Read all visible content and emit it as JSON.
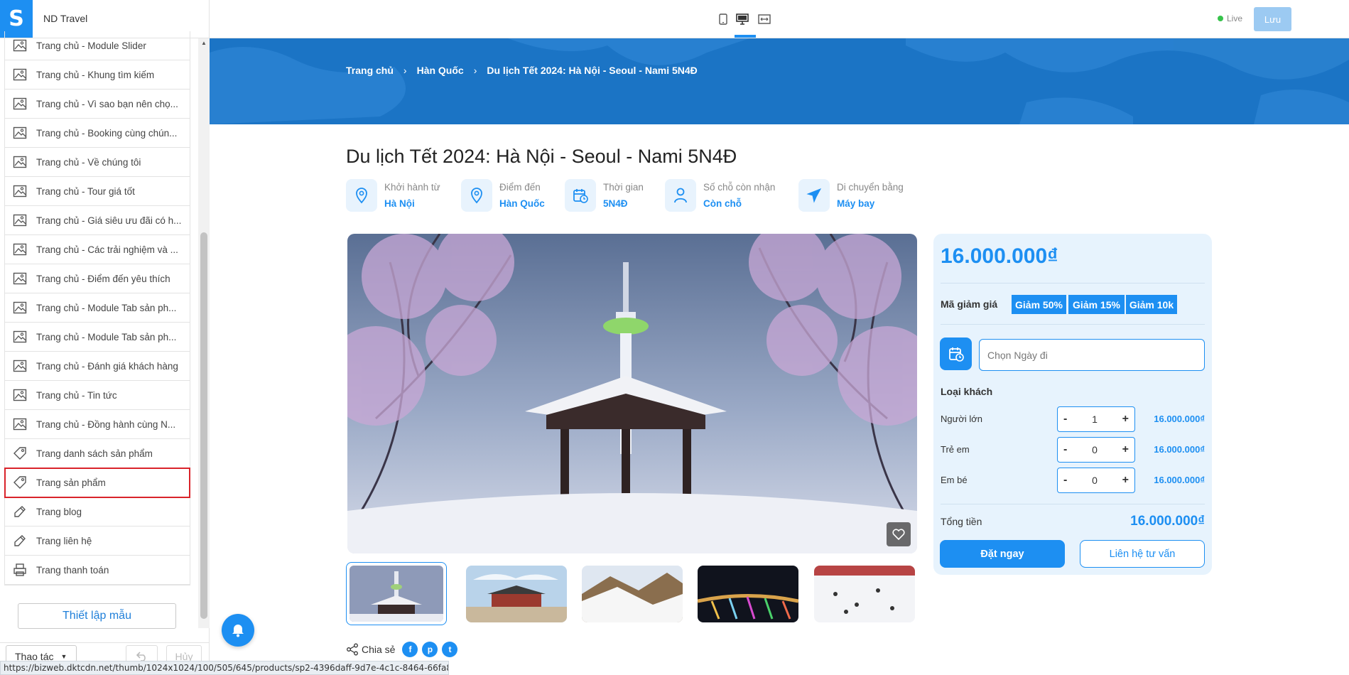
{
  "app": {
    "store_name": "ND Travel",
    "live_label": "Live",
    "save_label": "Lưu"
  },
  "sidebar": {
    "items": [
      {
        "label": "Trang chủ - Module Slider",
        "icon": "image-icon"
      },
      {
        "label": "Trang chủ - Khung tìm kiếm",
        "icon": "image-icon"
      },
      {
        "label": "Trang chủ - Vì sao bạn nên chọ...",
        "icon": "image-icon"
      },
      {
        "label": "Trang chủ - Booking cùng chún...",
        "icon": "image-icon"
      },
      {
        "label": "Trang chủ - Về chúng tôi",
        "icon": "image-icon"
      },
      {
        "label": "Trang chủ - Tour giá tốt",
        "icon": "image-icon"
      },
      {
        "label": "Trang chủ - Giá siêu ưu đãi có h...",
        "icon": "image-icon"
      },
      {
        "label": "Trang chủ - Các trải nghiệm và ...",
        "icon": "image-icon"
      },
      {
        "label": "Trang chủ - Điểm đến yêu thích",
        "icon": "image-icon"
      },
      {
        "label": "Trang chủ - Module Tab sản ph...",
        "icon": "image-icon"
      },
      {
        "label": "Trang chủ - Module Tab sản ph...",
        "icon": "image-icon"
      },
      {
        "label": "Trang chủ - Đánh giá khách hàng",
        "icon": "image-icon"
      },
      {
        "label": "Trang chủ - Tin tức",
        "icon": "image-icon"
      },
      {
        "label": "Trang chủ - Đồng hành cùng N...",
        "icon": "image-icon"
      },
      {
        "label": "Trang danh sách sản phẩm",
        "icon": "tag-icon"
      },
      {
        "label": "Trang sản phẩm",
        "icon": "tag-icon",
        "active": true
      },
      {
        "label": "Trang blog",
        "icon": "brush-icon"
      },
      {
        "label": "Trang liên hệ",
        "icon": "brush-icon"
      },
      {
        "label": "Trang thanh toán",
        "icon": "printer-icon"
      }
    ],
    "setup_button": "Thiết lập mẫu",
    "actions_label": "Thao tác",
    "cancel_label": "Hủy"
  },
  "status_url": "https://bizweb.dktcdn.net/thumb/1024x1024/100/505/645/products/sp2-4396daff-9d7e-4c1c-8464-66fa8b3e5f3e.jp...",
  "breadcrumb": [
    "Trang chủ",
    "Hàn Quốc",
    "Du lịch Tết 2024: Hà Nội - Seoul - Nami 5N4Đ"
  ],
  "product": {
    "title": "Du lịch Tết 2024: Hà Nội - Seoul - Nami 5N4Đ",
    "info": [
      {
        "label": "Khởi hành từ",
        "value": "Hà Nội",
        "icon": "location-pin-icon"
      },
      {
        "label": "Điểm đến",
        "value": "Hàn Quốc",
        "icon": "location-pin-icon"
      },
      {
        "label": "Thời gian",
        "value": "5N4Đ",
        "icon": "calendar-clock-icon"
      },
      {
        "label": "Số chỗ còn nhận",
        "value": "Còn chỗ",
        "icon": "person-icon"
      },
      {
        "label": "Di chuyển bằng",
        "value": "Máy bay",
        "icon": "airplane-icon"
      }
    ],
    "share_label": "Chia sẻ",
    "share_icons": [
      "facebook-icon",
      "pinterest-icon",
      "twitter-icon"
    ]
  },
  "booking": {
    "price": "16.000.000₫",
    "coupon_label": "Mã giảm giá",
    "coupons": [
      "Giảm 50%",
      "Giảm 15%",
      "Giảm 10k"
    ],
    "date_placeholder": "Chọn Ngày đi",
    "guest_type_label": "Loại khách",
    "guests": [
      {
        "label": "Người lớn",
        "qty": "1",
        "price": "16.000.000₫"
      },
      {
        "label": "Trẻ em",
        "qty": "0",
        "price": "16.000.000₫"
      },
      {
        "label": "Em bé",
        "qty": "0",
        "price": "16.000.000₫"
      }
    ],
    "total_label": "Tổng tiền",
    "total_value": "16.000.000₫",
    "book_label": "Đặt ngay",
    "contact_label": "Liên hệ tư vấn"
  },
  "colors": {
    "accent": "#1d8ff2",
    "banner": "#1b74c5",
    "active_outline": "#d9232a"
  }
}
